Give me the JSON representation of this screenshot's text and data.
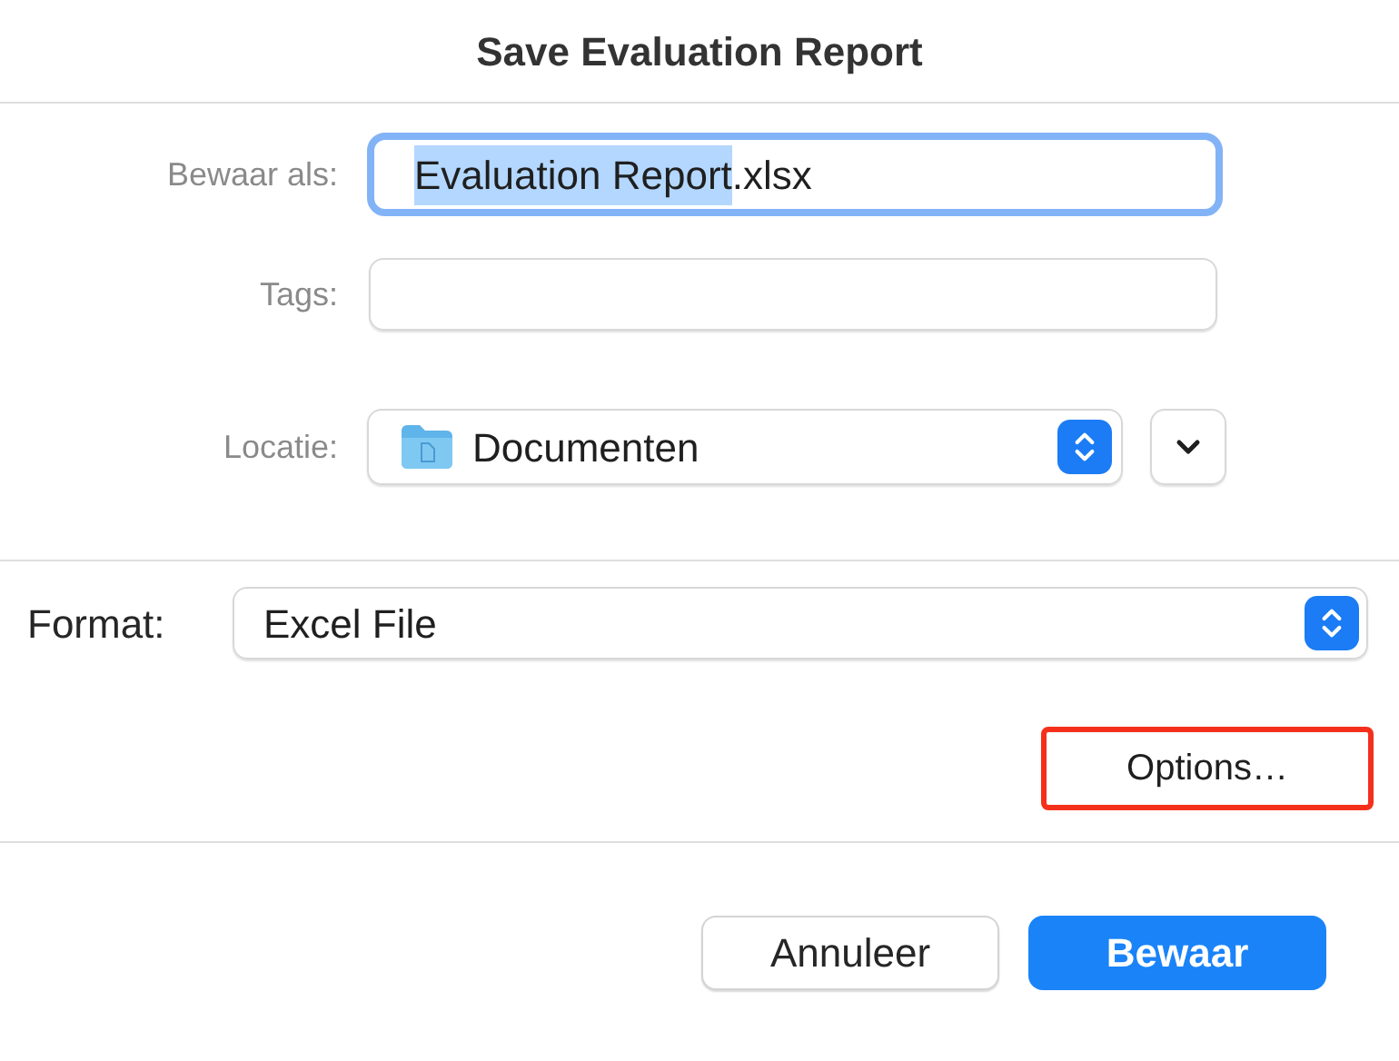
{
  "window": {
    "title": "Save Evaluation Report"
  },
  "save_as": {
    "label": "Bewaar als:",
    "selected_text": "Evaluation Report",
    "text": ".xlsx",
    "focused": true
  },
  "tags": {
    "label": "Tags:"
  },
  "location": {
    "label": "Locatie:",
    "value": "Documenten",
    "expanded": false
  },
  "format": {
    "label": "Format:",
    "value": "Excel File"
  },
  "options_button": {
    "label": "Options…",
    "highlighted": true
  },
  "buttons": [
    {
      "label": "Annuleer",
      "kind": "secondary"
    },
    {
      "label": "Bewaar",
      "kind": "primary"
    }
  ]
}
